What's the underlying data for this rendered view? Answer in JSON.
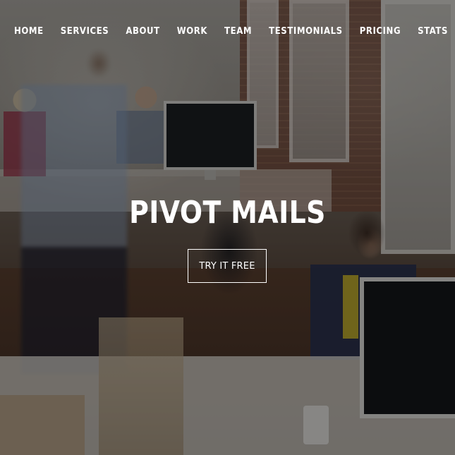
{
  "nav": {
    "items": [
      {
        "label": "HOME"
      },
      {
        "label": "SERVICES"
      },
      {
        "label": "ABOUT"
      },
      {
        "label": "WORK"
      },
      {
        "label": "TEAM"
      },
      {
        "label": "TESTIMONIALS"
      },
      {
        "label": "PRICING"
      },
      {
        "label": "STATS"
      }
    ]
  },
  "hero": {
    "title": "PIVOT MAILS",
    "cta_label": "TRY IT FREE",
    "background_image": "office-workspace-photo",
    "overlay_color": "#000000"
  }
}
